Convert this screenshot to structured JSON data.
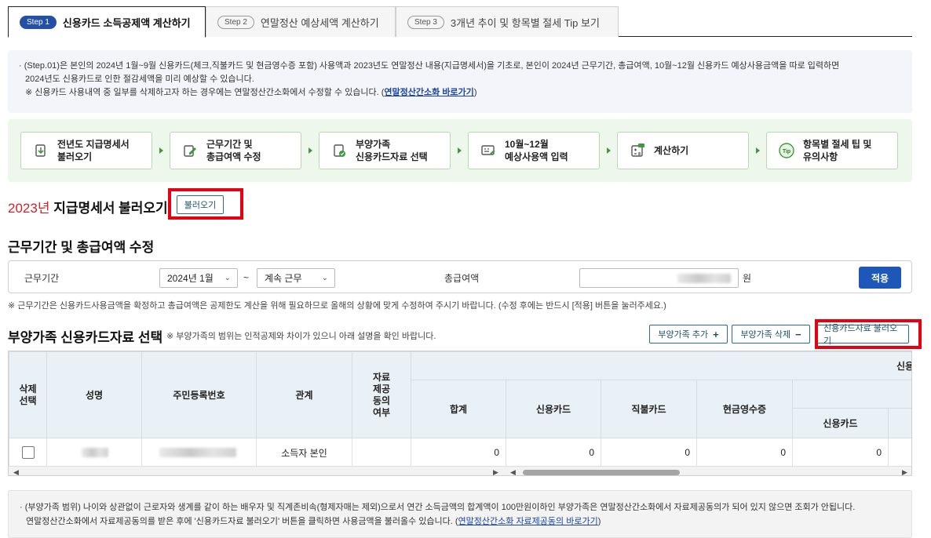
{
  "tabs": [
    {
      "step": "Step 1",
      "label": "신용카드 소득공제액 계산하기"
    },
    {
      "step": "Step 2",
      "label": "연말정산 예상세액 계산하기"
    },
    {
      "step": "Step 3",
      "label": "3개년 추이 및 항목별 절세 Tip 보기"
    }
  ],
  "info": {
    "line1": "· (Step.01)은 본인의 2024년 1월~9월 신용카드(체크,직불카드 및 현금영수증 포함) 사용액과 2023년도 연말정산 내용(지급명세서)을 기초로, 본인이 2024년 근무기간, 총급여액, 10월~12월 신용카드 예상사용금액을 따로 입력하면",
    "line2": "2024년도 신용카드로 인한 절감세액을 미리 예상할 수 있습니다.",
    "line3_prefix": "※ 신용카드 사용내역 중 일부를 삭제하고자 하는 경우에는 연말정산간소화에서 수정할 수 있습니다. (",
    "line3_link": "연말정산간소화 바로가기",
    "line3_suffix": ")"
  },
  "process": [
    {
      "icon": "document-import-icon",
      "label": "전년도 지급명세서\n불러오기"
    },
    {
      "icon": "edit-icon",
      "label": "근무기간 및\n총급여액 수정"
    },
    {
      "icon": "card-check-icon",
      "label": "부양가족\n신용카드자료 선택"
    },
    {
      "icon": "card-input-icon",
      "label": "10월~12월\n예상사용액 입력"
    },
    {
      "icon": "calculator-icon",
      "label": "계산하기"
    },
    {
      "icon": "tip-icon",
      "label": "항목별 절세 팁 및\n유의사항"
    }
  ],
  "statement": {
    "year": "2023년",
    "title": " 지급명세서 불러오기",
    "button": "불러오기"
  },
  "period_section": {
    "title": "근무기간 및 총급여액 수정",
    "period_label": "근무기간",
    "start_select": "2024년 1월",
    "tilde": "~",
    "end_select": "계속 근무",
    "salary_label": "총급여액",
    "unit": "원",
    "apply_button": "적용",
    "note": "※ 근무기간은 신용카드사용금액을 확정하고 총급여액은 공제한도 계산을 위해 필요하므로 올해의 상황에 맞게 수정하여 주시기 바랍니다. (수정 후에는 반드시 [적용] 버튼을 눌러주세요.)"
  },
  "dependents": {
    "title": "부양가족 신용카드자료 선택",
    "subnote": "※ 부양가족의 범위는 인적공제와 차이가 있으니 아래 설명을 확인 바랍니다.",
    "add_button": "부양가족 추가",
    "add_symbol": "+",
    "delete_button": "부양가족 삭제",
    "delete_symbol": "−",
    "load_button": "신용카드자료 불러오기"
  },
  "table": {
    "headers": {
      "delete": "삭제\n선택",
      "name": "성명",
      "rrn": "주민등록번호",
      "relation": "관계",
      "consent": "자료\n제공\n동의\n여부",
      "group": "신용",
      "total": "합계",
      "credit": "신용카드",
      "debit": "직불카드",
      "cash": "현금영수증",
      "sub_group": "",
      "sub_credit": "신용카드"
    },
    "rows": [
      {
        "relation": "소득자 본인",
        "total": "0",
        "credit": "0",
        "debit": "0",
        "cash": "0",
        "sub_credit": "0"
      }
    ]
  },
  "bottom_info": {
    "line1": "· (부양가족 범위) 나이와 상관없이 근로자와 생계를 같이 하는 배우자 및 직계존비속(형제자매는 제외)으로서 연간 소득금액의 합계액이 100만원이하인 부양가족은 연말정산간소화에서 자료제공동의가 되어 있지 않으면 조회가 안됩니다.",
    "line2_prefix": "연말정산간소화에서 자료제공동의를 받은 후에 '신용카드자료 불러오기' 버튼을 클릭하면 사용금액을 불러올수 있습니다. (",
    "line2_link": "연말정산간소화 자료제공동의 바로가기",
    "line2_suffix": ")"
  },
  "colors": {
    "primary": "#1d57b8",
    "highlight": "#e60012",
    "year_red": "#d4202a",
    "process_bg": "#eef7ec"
  }
}
